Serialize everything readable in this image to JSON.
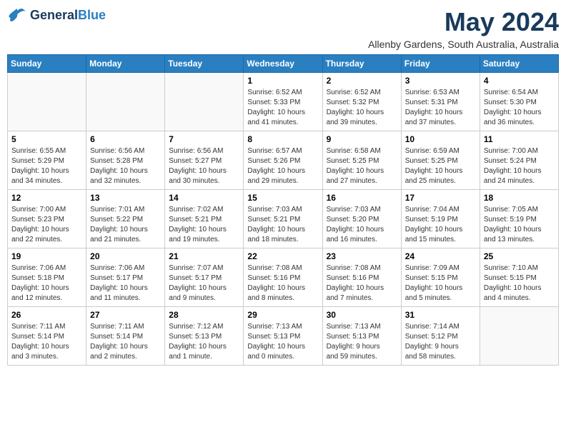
{
  "header": {
    "logo_general": "General",
    "logo_blue": "Blue",
    "month_title": "May 2024",
    "location": "Allenby Gardens, South Australia, Australia"
  },
  "calendar": {
    "days_of_week": [
      "Sunday",
      "Monday",
      "Tuesday",
      "Wednesday",
      "Thursday",
      "Friday",
      "Saturday"
    ],
    "weeks": [
      [
        {
          "day": "",
          "info": ""
        },
        {
          "day": "",
          "info": ""
        },
        {
          "day": "",
          "info": ""
        },
        {
          "day": "1",
          "info": "Sunrise: 6:52 AM\nSunset: 5:33 PM\nDaylight: 10 hours\nand 41 minutes."
        },
        {
          "day": "2",
          "info": "Sunrise: 6:52 AM\nSunset: 5:32 PM\nDaylight: 10 hours\nand 39 minutes."
        },
        {
          "day": "3",
          "info": "Sunrise: 6:53 AM\nSunset: 5:31 PM\nDaylight: 10 hours\nand 37 minutes."
        },
        {
          "day": "4",
          "info": "Sunrise: 6:54 AM\nSunset: 5:30 PM\nDaylight: 10 hours\nand 36 minutes."
        }
      ],
      [
        {
          "day": "5",
          "info": "Sunrise: 6:55 AM\nSunset: 5:29 PM\nDaylight: 10 hours\nand 34 minutes."
        },
        {
          "day": "6",
          "info": "Sunrise: 6:56 AM\nSunset: 5:28 PM\nDaylight: 10 hours\nand 32 minutes."
        },
        {
          "day": "7",
          "info": "Sunrise: 6:56 AM\nSunset: 5:27 PM\nDaylight: 10 hours\nand 30 minutes."
        },
        {
          "day": "8",
          "info": "Sunrise: 6:57 AM\nSunset: 5:26 PM\nDaylight: 10 hours\nand 29 minutes."
        },
        {
          "day": "9",
          "info": "Sunrise: 6:58 AM\nSunset: 5:25 PM\nDaylight: 10 hours\nand 27 minutes."
        },
        {
          "day": "10",
          "info": "Sunrise: 6:59 AM\nSunset: 5:25 PM\nDaylight: 10 hours\nand 25 minutes."
        },
        {
          "day": "11",
          "info": "Sunrise: 7:00 AM\nSunset: 5:24 PM\nDaylight: 10 hours\nand 24 minutes."
        }
      ],
      [
        {
          "day": "12",
          "info": "Sunrise: 7:00 AM\nSunset: 5:23 PM\nDaylight: 10 hours\nand 22 minutes."
        },
        {
          "day": "13",
          "info": "Sunrise: 7:01 AM\nSunset: 5:22 PM\nDaylight: 10 hours\nand 21 minutes."
        },
        {
          "day": "14",
          "info": "Sunrise: 7:02 AM\nSunset: 5:21 PM\nDaylight: 10 hours\nand 19 minutes."
        },
        {
          "day": "15",
          "info": "Sunrise: 7:03 AM\nSunset: 5:21 PM\nDaylight: 10 hours\nand 18 minutes."
        },
        {
          "day": "16",
          "info": "Sunrise: 7:03 AM\nSunset: 5:20 PM\nDaylight: 10 hours\nand 16 minutes."
        },
        {
          "day": "17",
          "info": "Sunrise: 7:04 AM\nSunset: 5:19 PM\nDaylight: 10 hours\nand 15 minutes."
        },
        {
          "day": "18",
          "info": "Sunrise: 7:05 AM\nSunset: 5:19 PM\nDaylight: 10 hours\nand 13 minutes."
        }
      ],
      [
        {
          "day": "19",
          "info": "Sunrise: 7:06 AM\nSunset: 5:18 PM\nDaylight: 10 hours\nand 12 minutes."
        },
        {
          "day": "20",
          "info": "Sunrise: 7:06 AM\nSunset: 5:17 PM\nDaylight: 10 hours\nand 11 minutes."
        },
        {
          "day": "21",
          "info": "Sunrise: 7:07 AM\nSunset: 5:17 PM\nDaylight: 10 hours\nand 9 minutes."
        },
        {
          "day": "22",
          "info": "Sunrise: 7:08 AM\nSunset: 5:16 PM\nDaylight: 10 hours\nand 8 minutes."
        },
        {
          "day": "23",
          "info": "Sunrise: 7:08 AM\nSunset: 5:16 PM\nDaylight: 10 hours\nand 7 minutes."
        },
        {
          "day": "24",
          "info": "Sunrise: 7:09 AM\nSunset: 5:15 PM\nDaylight: 10 hours\nand 5 minutes."
        },
        {
          "day": "25",
          "info": "Sunrise: 7:10 AM\nSunset: 5:15 PM\nDaylight: 10 hours\nand 4 minutes."
        }
      ],
      [
        {
          "day": "26",
          "info": "Sunrise: 7:11 AM\nSunset: 5:14 PM\nDaylight: 10 hours\nand 3 minutes."
        },
        {
          "day": "27",
          "info": "Sunrise: 7:11 AM\nSunset: 5:14 PM\nDaylight: 10 hours\nand 2 minutes."
        },
        {
          "day": "28",
          "info": "Sunrise: 7:12 AM\nSunset: 5:13 PM\nDaylight: 10 hours\nand 1 minute."
        },
        {
          "day": "29",
          "info": "Sunrise: 7:13 AM\nSunset: 5:13 PM\nDaylight: 10 hours\nand 0 minutes."
        },
        {
          "day": "30",
          "info": "Sunrise: 7:13 AM\nSunset: 5:13 PM\nDaylight: 9 hours\nand 59 minutes."
        },
        {
          "day": "31",
          "info": "Sunrise: 7:14 AM\nSunset: 5:12 PM\nDaylight: 9 hours\nand 58 minutes."
        },
        {
          "day": "",
          "info": ""
        }
      ]
    ]
  }
}
